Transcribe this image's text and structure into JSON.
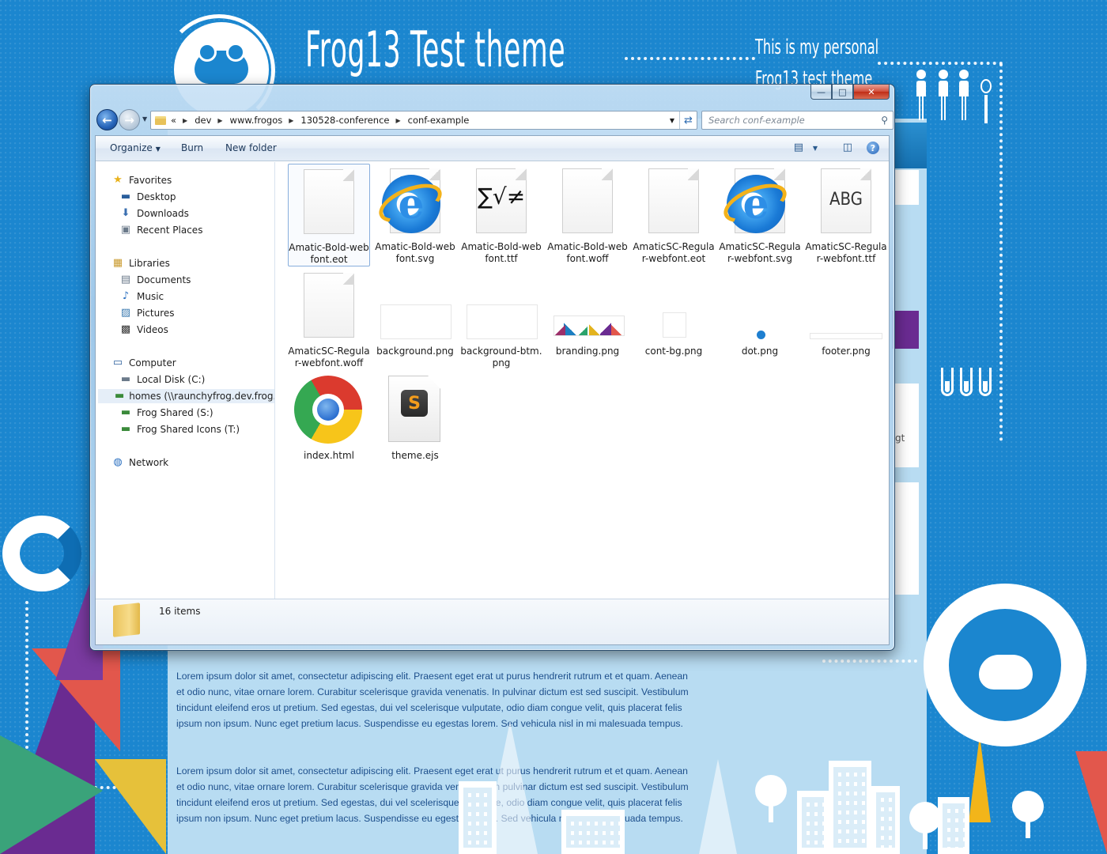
{
  "website": {
    "title": "Frog13 Test theme",
    "subtitle_line1": "This is my personal",
    "subtitle_line2": "Frog13 test theme",
    "lorem_1": "Lorem ipsum dolor sit amet, consectetur adipiscing elit. Praesent eget erat ut purus hendrerit rutrum et et quam. Aenean et odio nunc, vitae ornare lorem. Curabitur scelerisque gravida venenatis. In pulvinar dictum est sed suscipit. Vestibulum tincidunt eleifend eros ut pretium. Sed egestas, dui vel scelerisque vulputate, odio diam congue velit, quis placerat felis ipsum non ipsum. Nunc eget pretium lacus. Suspendisse eu egestas lorem. Sed vehicula nisl in mi malesuada tempus.",
    "lorem_2": "Lorem ipsum dolor sit amet, consectetur adipiscing elit. Praesent eget erat ut purus hendrerit rutrum et et quam. Aenean et odio nunc, vitae ornare lorem. Curabitur scelerisque gravida venenatis. In pulvinar dictum est sed suscipit. Vestibulum tincidunt eleifend eros ut pretium. Sed egestas, dui vel scelerisque vulputate, odio diam congue velit, quis placerat felis ipsum non ipsum. Nunc eget pretium lacus. Suspendisse eu egestas lorem. Sed vehicula nisl in mi malesuada tempus.",
    "partial_right_text": "gt",
    "colors": {
      "background": "#1b86cf",
      "panel": "#b8dcf2",
      "accent_purple": "#6a2b91"
    }
  },
  "window": {
    "caption_buttons": {
      "minimize": "—",
      "maximize": "□",
      "close": "✕"
    },
    "breadcrumb": {
      "overflow": "«",
      "items": [
        "dev",
        "www.frogos",
        "130528-conference",
        "conf-example"
      ]
    },
    "search": {
      "placeholder": "Search conf-example"
    },
    "toolbar": {
      "organize": "Organize",
      "burn": "Burn",
      "new_folder": "New folder"
    },
    "navigation": {
      "favorites": "Favorites",
      "desktop": "Desktop",
      "downloads": "Downloads",
      "recent_places": "Recent Places",
      "libraries": "Libraries",
      "documents": "Documents",
      "music": "Music",
      "pictures": "Pictures",
      "videos": "Videos",
      "computer": "Computer",
      "local_disk": "Local Disk (C:)",
      "homes": "homes (\\\\raunchyfrog.dev.frog.lo",
      "frog_shared": "Frog Shared (S:)",
      "frog_shared_icons": "Frog Shared Icons (T:)",
      "network": "Network"
    },
    "files": [
      {
        "name": "Amatic-Bold-webfont.eot",
        "icon": "blank-document-icon"
      },
      {
        "name": "Amatic-Bold-webfont.svg",
        "icon": "internet-explorer-icon"
      },
      {
        "name": "Amatic-Bold-webfont.ttf",
        "icon": "font-glyph-icon",
        "glyph": "∑√≠"
      },
      {
        "name": "Amatic-Bold-webfont.woff",
        "icon": "blank-document-icon"
      },
      {
        "name": "AmaticSC-Regular-webfont.eot",
        "icon": "blank-document-icon"
      },
      {
        "name": "AmaticSC-Regular-webfont.svg",
        "icon": "internet-explorer-icon"
      },
      {
        "name": "AmaticSC-Regular-webfont.ttf",
        "icon": "font-preview-icon",
        "glyph": "ABG"
      },
      {
        "name": "AmaticSC-Regular-webfont.woff",
        "icon": "blank-document-icon"
      },
      {
        "name": "background.png",
        "icon": "image-thumbnail-icon"
      },
      {
        "name": "background-btm.png",
        "icon": "image-thumbnail-icon"
      },
      {
        "name": "branding.png",
        "icon": "branding-thumbnail-icon"
      },
      {
        "name": "cont-bg.png",
        "icon": "image-thumbnail-icon"
      },
      {
        "name": "dot.png",
        "icon": "dot-thumbnail-icon"
      },
      {
        "name": "footer.png",
        "icon": "image-thumbnail-icon"
      },
      {
        "name": "index.html",
        "icon": "chrome-icon"
      },
      {
        "name": "theme.ejs",
        "icon": "sublime-text-icon",
        "glyph": "S"
      }
    ],
    "status": {
      "item_count": "16 items"
    }
  }
}
